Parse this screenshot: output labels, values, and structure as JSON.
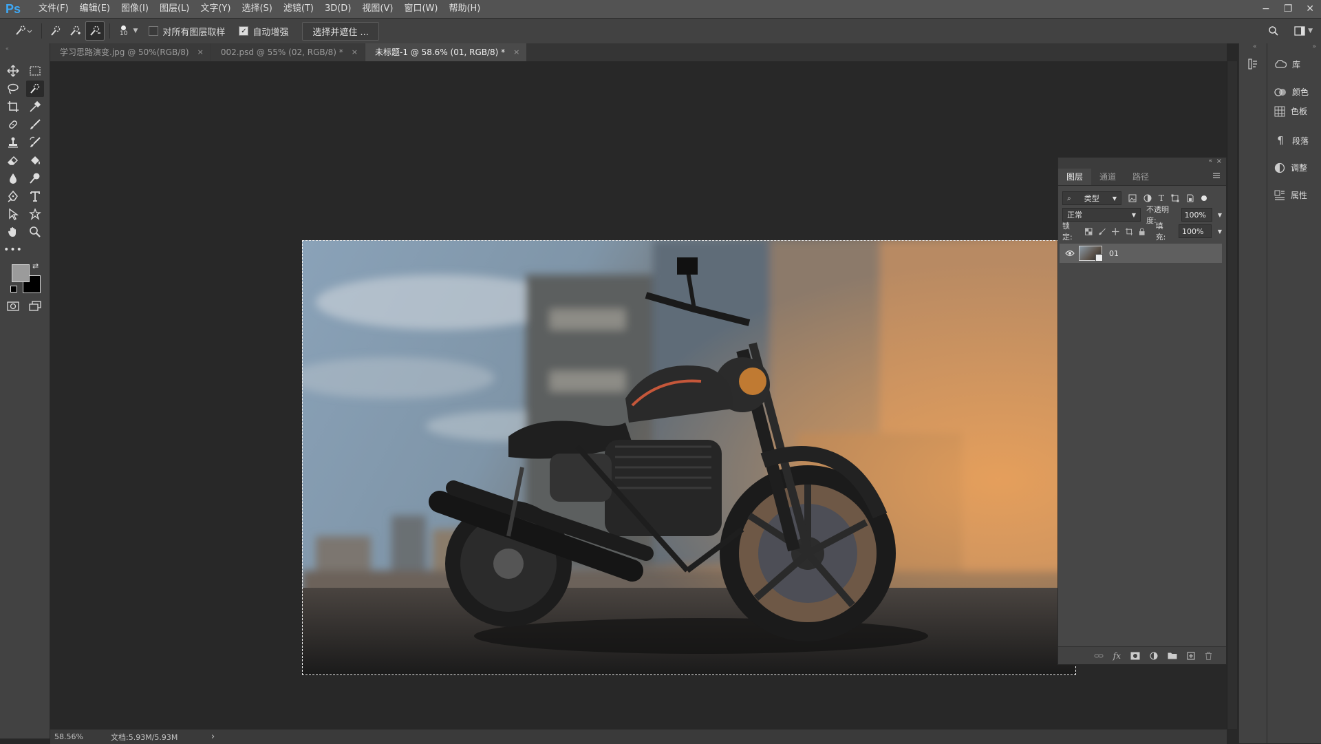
{
  "app": {
    "logo": "Ps"
  },
  "menu": [
    "文件(F)",
    "编辑(E)",
    "图像(I)",
    "图层(L)",
    "文字(Y)",
    "选择(S)",
    "滤镜(T)",
    "3D(D)",
    "视图(V)",
    "窗口(W)",
    "帮助(H)"
  ],
  "window_controls": {
    "minimize": "−",
    "restore": "❐",
    "close": "✕"
  },
  "options": {
    "brush_size": "10",
    "sample_all_layers": {
      "label": "对所有图层取样",
      "checked": false
    },
    "auto_enhance": {
      "label": "自动增强",
      "checked": true
    },
    "select_and_mask": "选择并遮住 ..."
  },
  "tabs": [
    {
      "label": "学习思路演变.jpg @ 50%(RGB/8)",
      "active": false
    },
    {
      "label": "002.psd @ 55% (02, RGB/8) *",
      "active": false
    },
    {
      "label": "未标题-1 @ 58.6% (01, RGB/8) *",
      "active": true
    }
  ],
  "tab_close": "×",
  "status": {
    "zoom": "58.56%",
    "doc": "文档:5.93M/5.93M",
    "arrow": "›"
  },
  "layers_panel": {
    "tabs": [
      "图层",
      "通道",
      "路径"
    ],
    "filter_kind": "类型",
    "blend_mode": "正常",
    "opacity_label": "不透明度:",
    "opacity_value": "100%",
    "lock_label": "锁定:",
    "fill_label": "填充:",
    "fill_value": "100%",
    "layer_name": "01"
  },
  "dock": [
    {
      "label": "库",
      "icon": "library-icon"
    },
    {
      "label": "颜色",
      "icon": "color-icon"
    },
    {
      "label": "色板",
      "icon": "swatches-icon"
    },
    {
      "label": "段落",
      "icon": "paragraph-icon"
    },
    {
      "label": "调整",
      "icon": "adjustments-icon"
    },
    {
      "label": "属性",
      "icon": "properties-icon"
    }
  ],
  "colors": {
    "accent": "#3ea8f5",
    "foreground": "#9b9b9b",
    "background": "#000000"
  }
}
